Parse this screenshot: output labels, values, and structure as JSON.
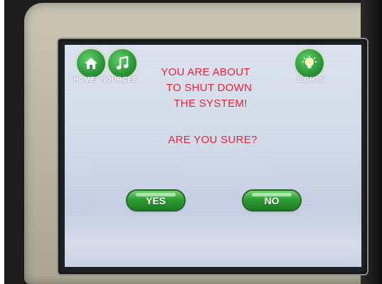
{
  "nav": {
    "home": {
      "label": "HOME",
      "icon": "home-icon"
    },
    "sources": {
      "label": "SOURCES",
      "icon": "music-note-icon"
    },
    "lights": {
      "label": "LIGHTS",
      "icon": "light-bulb-icon"
    }
  },
  "dialog": {
    "line1": "YOU ARE ABOUT",
    "line2": "TO SHUT DOWN",
    "line3": "THE SYSTEM!",
    "question": "ARE YOU SURE?",
    "yes_label": "YES",
    "no_label": "NO"
  },
  "colors": {
    "message_text": "#e1263c",
    "button_green": "#2f9e34",
    "screen_background": "#d6deef"
  }
}
